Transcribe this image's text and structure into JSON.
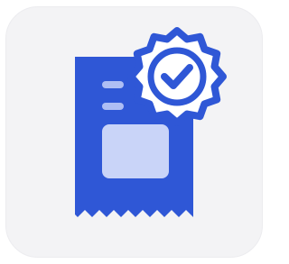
{
  "icon": {
    "name": "verified-receipt-icon",
    "parts": [
      "receipt-icon",
      "verified-badge-icon",
      "checkmark-icon"
    ]
  },
  "colors": {
    "tile_background": "#f3f3f5",
    "primary_blue": "#2f57d6",
    "light_blue": "#c9d4f8",
    "line_blue": "#aebef4",
    "badge_fill": "#ffffff"
  }
}
